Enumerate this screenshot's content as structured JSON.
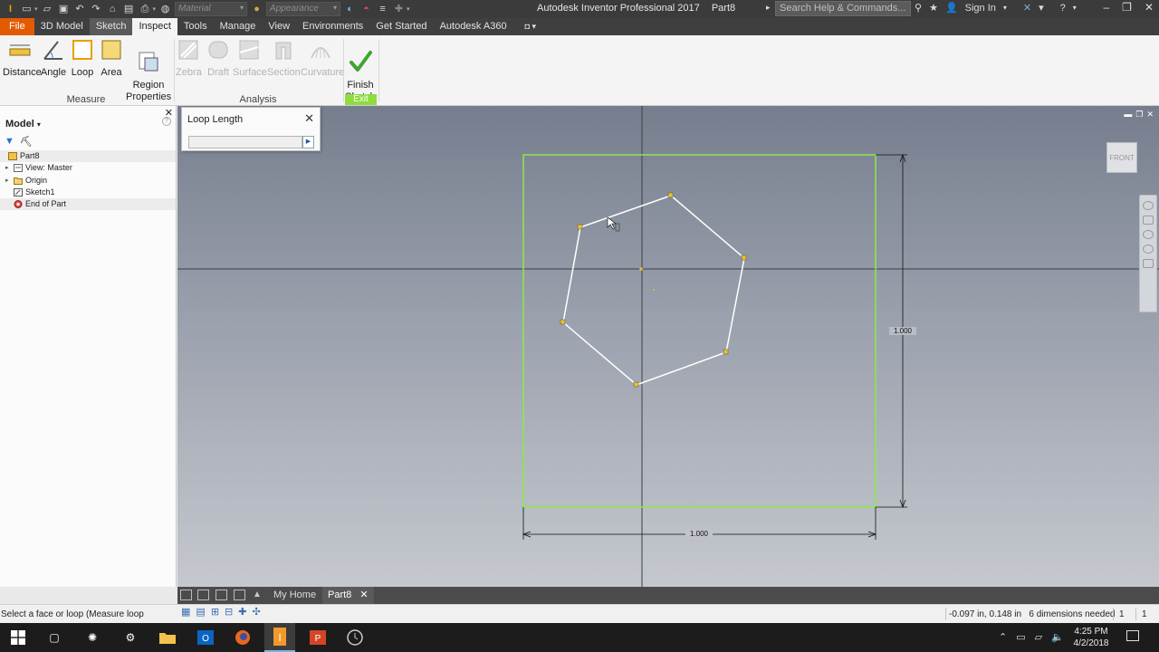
{
  "app_title": "Autodesk Inventor Professional 2017",
  "doc_title": "Part8",
  "quick_access": {
    "material_placeholder": "Material",
    "appearance_placeholder": "Appearance"
  },
  "search_placeholder": "Search Help & Commands...",
  "sign_in": "Sign In",
  "tabs": [
    "File",
    "3D Model",
    "Sketch",
    "Inspect",
    "Tools",
    "Manage",
    "View",
    "Environments",
    "Get Started",
    "Autodesk A360"
  ],
  "active_tab": "Inspect",
  "ribbon": {
    "measure": {
      "label": "Measure",
      "buttons": [
        "Distance",
        "Angle",
        "Loop",
        "Area",
        "Region\nProperties"
      ]
    },
    "analysis": {
      "label": "Analysis",
      "buttons": [
        "Zebra",
        "Draft",
        "Surface",
        "Section",
        "Curvature"
      ]
    },
    "exit": {
      "label": "Exit",
      "button": "Finish\nSketch"
    }
  },
  "browser": {
    "title": "Model",
    "tree": [
      "Part8",
      "View: Master",
      "Origin",
      "Sketch1",
      "End of Part"
    ]
  },
  "dialog": {
    "title": "Loop Length",
    "value": ""
  },
  "viewport": {
    "viewcube_label": "FRONT",
    "dim_vertical": "1.000",
    "dim_horizontal": "1.000"
  },
  "doc_tabs": {
    "home": "My Home",
    "part": "Part8"
  },
  "status": {
    "message": "Select a face or loop (Measure loop",
    "coords": "-0.097 in, 0.148 in",
    "dims_needed": "6 dimensions needed",
    "count1": "1",
    "count2": "1"
  },
  "clock": {
    "time": "4:25 PM",
    "date": "4/2/2018"
  },
  "colors": {
    "file_tab": "#e35b00",
    "sketch_square": "#8ee84a",
    "exit_label": "#8fdc3f",
    "titlebar": "#3b3b3b"
  }
}
